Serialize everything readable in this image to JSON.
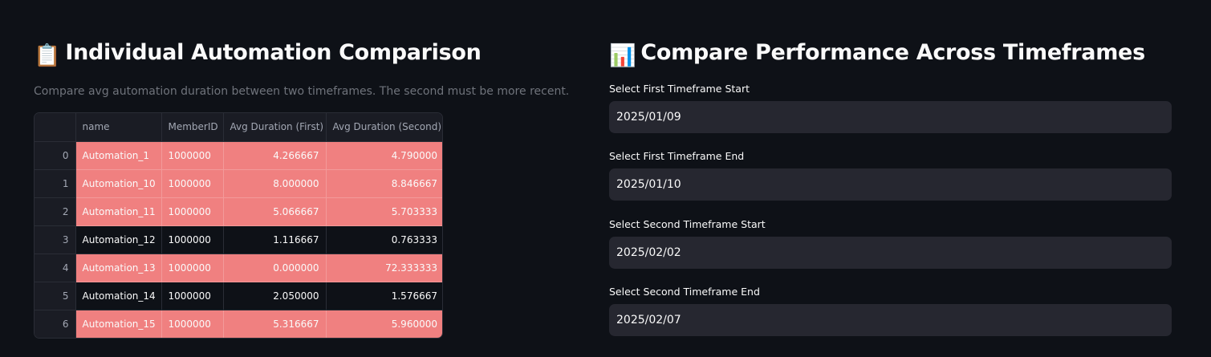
{
  "left": {
    "title_emoji": "📋",
    "title": "Individual Automation Comparison",
    "caption": "Compare avg automation duration between two timeframes. The second must be more recent.",
    "highlight_color": "#f08080",
    "table": {
      "columns": [
        "",
        "name",
        "MemberID",
        "Avg Duration (First)",
        "Avg Duration (Second)"
      ],
      "rows": [
        {
          "index": "0",
          "name": "Automation_1",
          "member_id": "1000000",
          "first": "4.266667",
          "second": "4.790000",
          "highlighted": true
        },
        {
          "index": "1",
          "name": "Automation_10",
          "member_id": "1000000",
          "first": "8.000000",
          "second": "8.846667",
          "highlighted": true
        },
        {
          "index": "2",
          "name": "Automation_11",
          "member_id": "1000000",
          "first": "5.066667",
          "second": "5.703333",
          "highlighted": true
        },
        {
          "index": "3",
          "name": "Automation_12",
          "member_id": "1000000",
          "first": "1.116667",
          "second": "0.763333",
          "highlighted": false
        },
        {
          "index": "4",
          "name": "Automation_13",
          "member_id": "1000000",
          "first": "0.000000",
          "second": "72.333333",
          "highlighted": true
        },
        {
          "index": "5",
          "name": "Automation_14",
          "member_id": "1000000",
          "first": "2.050000",
          "second": "1.576667",
          "highlighted": false
        },
        {
          "index": "6",
          "name": "Automation_15",
          "member_id": "1000000",
          "first": "5.316667",
          "second": "5.960000",
          "highlighted": true
        }
      ]
    }
  },
  "right": {
    "title_emoji": "📊",
    "title": "Compare Performance Across Timeframes",
    "fields": [
      {
        "label": "Select First Timeframe Start",
        "value": "2025/01/09"
      },
      {
        "label": "Select First Timeframe End",
        "value": "2025/01/10"
      },
      {
        "label": "Select Second Timeframe Start",
        "value": "2025/02/02"
      },
      {
        "label": "Select Second Timeframe End",
        "value": "2025/02/07"
      }
    ]
  }
}
